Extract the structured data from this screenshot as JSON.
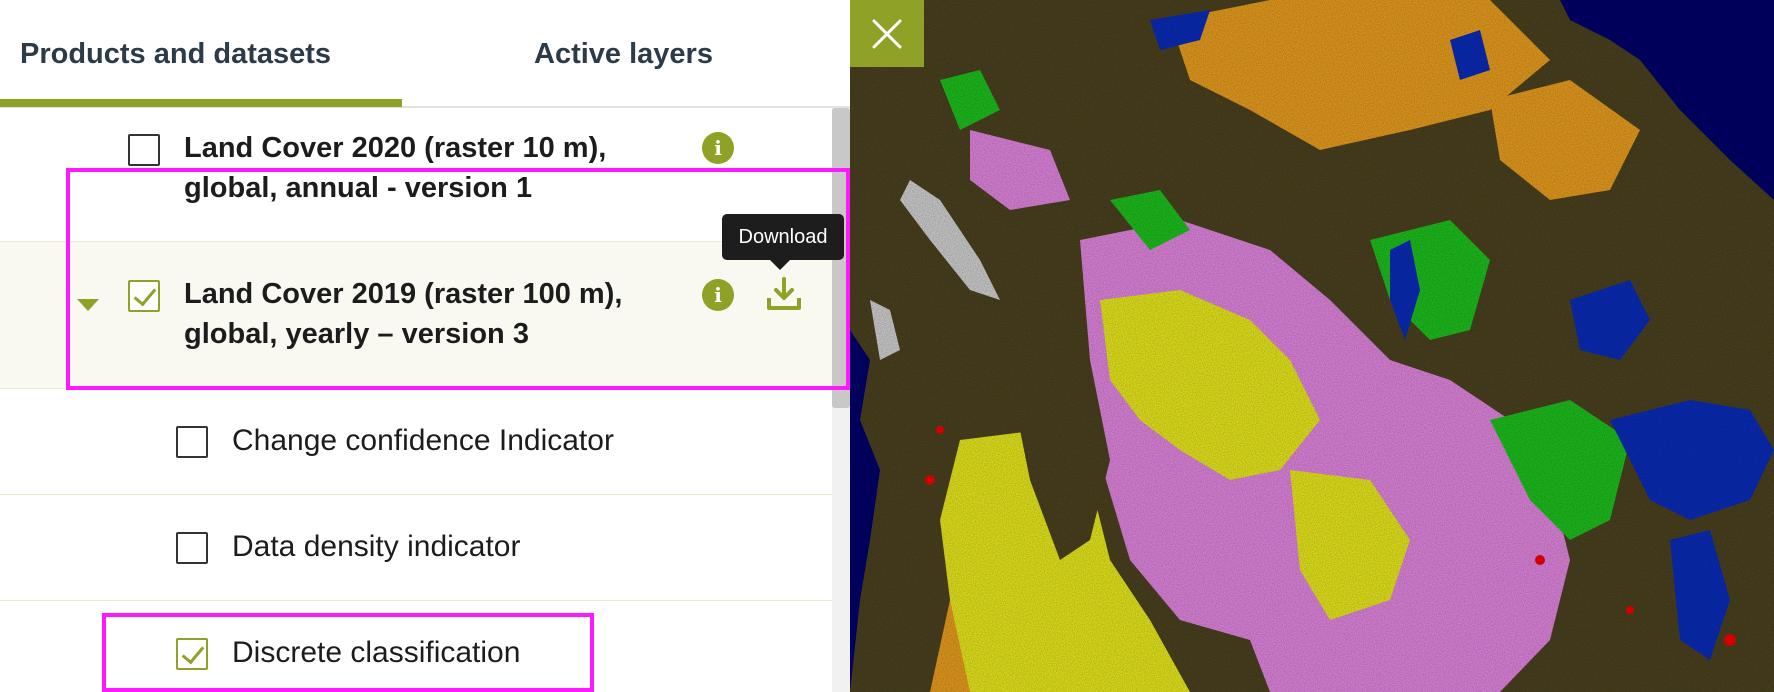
{
  "tabs": {
    "products": "Products and datasets",
    "active": "Active layers"
  },
  "layers": [
    {
      "title_line1": "Land Cover 2020 (raster 10 m),",
      "title_line2": "global, annual - version 1",
      "checked": false
    },
    {
      "title_line1": "Land Cover 2019 (raster 100 m),",
      "title_line2": "global, yearly – version 3",
      "checked": true,
      "expanded": true
    }
  ],
  "sublayers": [
    {
      "label": "Change confidence Indicator",
      "checked": false
    },
    {
      "label": "Data density indicator",
      "checked": false
    },
    {
      "label": "Discrete classification",
      "checked": true
    }
  ],
  "tooltip": "Download",
  "icons": {
    "info": "info-icon",
    "download": "download-icon",
    "expand": "caret-down-icon",
    "close": "close-icon"
  },
  "colors": {
    "accent": "#8fa126",
    "highlight": "#ff19ff",
    "map_forest": "#4e4420",
    "map_cropland": "#f2f21f",
    "map_grassland": "#ea8be8",
    "map_shrub": "#f2a41f",
    "map_water": "#0a2dc0",
    "map_ocean": "#00006e",
    "map_green": "#1ec81e",
    "map_snow": "#d9d9d9",
    "map_urban": "#ff0000"
  }
}
